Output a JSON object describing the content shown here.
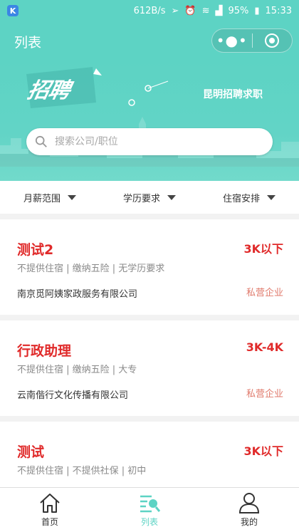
{
  "status_bar": {
    "speed": "612B/s",
    "battery": "95%",
    "time": "15:33"
  },
  "nav": {
    "title": "列表"
  },
  "banner": {
    "logo": "招聘",
    "slogan": "昆明招聘求职"
  },
  "search": {
    "placeholder": "搜索公司/职位"
  },
  "filters": [
    {
      "label": "月薪范围"
    },
    {
      "label": "学历要求"
    },
    {
      "label": "住宿安排"
    }
  ],
  "jobs": [
    {
      "title": "测试2",
      "salary": "3K以下",
      "tags": "不提供住宿 | 缴纳五险 | 无学历要求",
      "company": "南京觅阿姨家政服务有限公司",
      "type": "私营企业"
    },
    {
      "title": "行政助理",
      "salary": "3K-4K",
      "tags": "不提供住宿 | 缴纳五险 | 大专",
      "company": "云南偕行文化传播有限公司",
      "type": "私营企业"
    },
    {
      "title": "测试",
      "salary": "3K以下",
      "tags": "不提供住宿 | 不提供社保 | 初中",
      "company": "",
      "type": ""
    }
  ],
  "tabs": [
    {
      "label": "首页"
    },
    {
      "label": "列表"
    },
    {
      "label": "我的"
    }
  ],
  "colors": {
    "primary": "#5dd3c4",
    "accent_red": "#e02a2a",
    "company_type": "#e07a6c"
  }
}
